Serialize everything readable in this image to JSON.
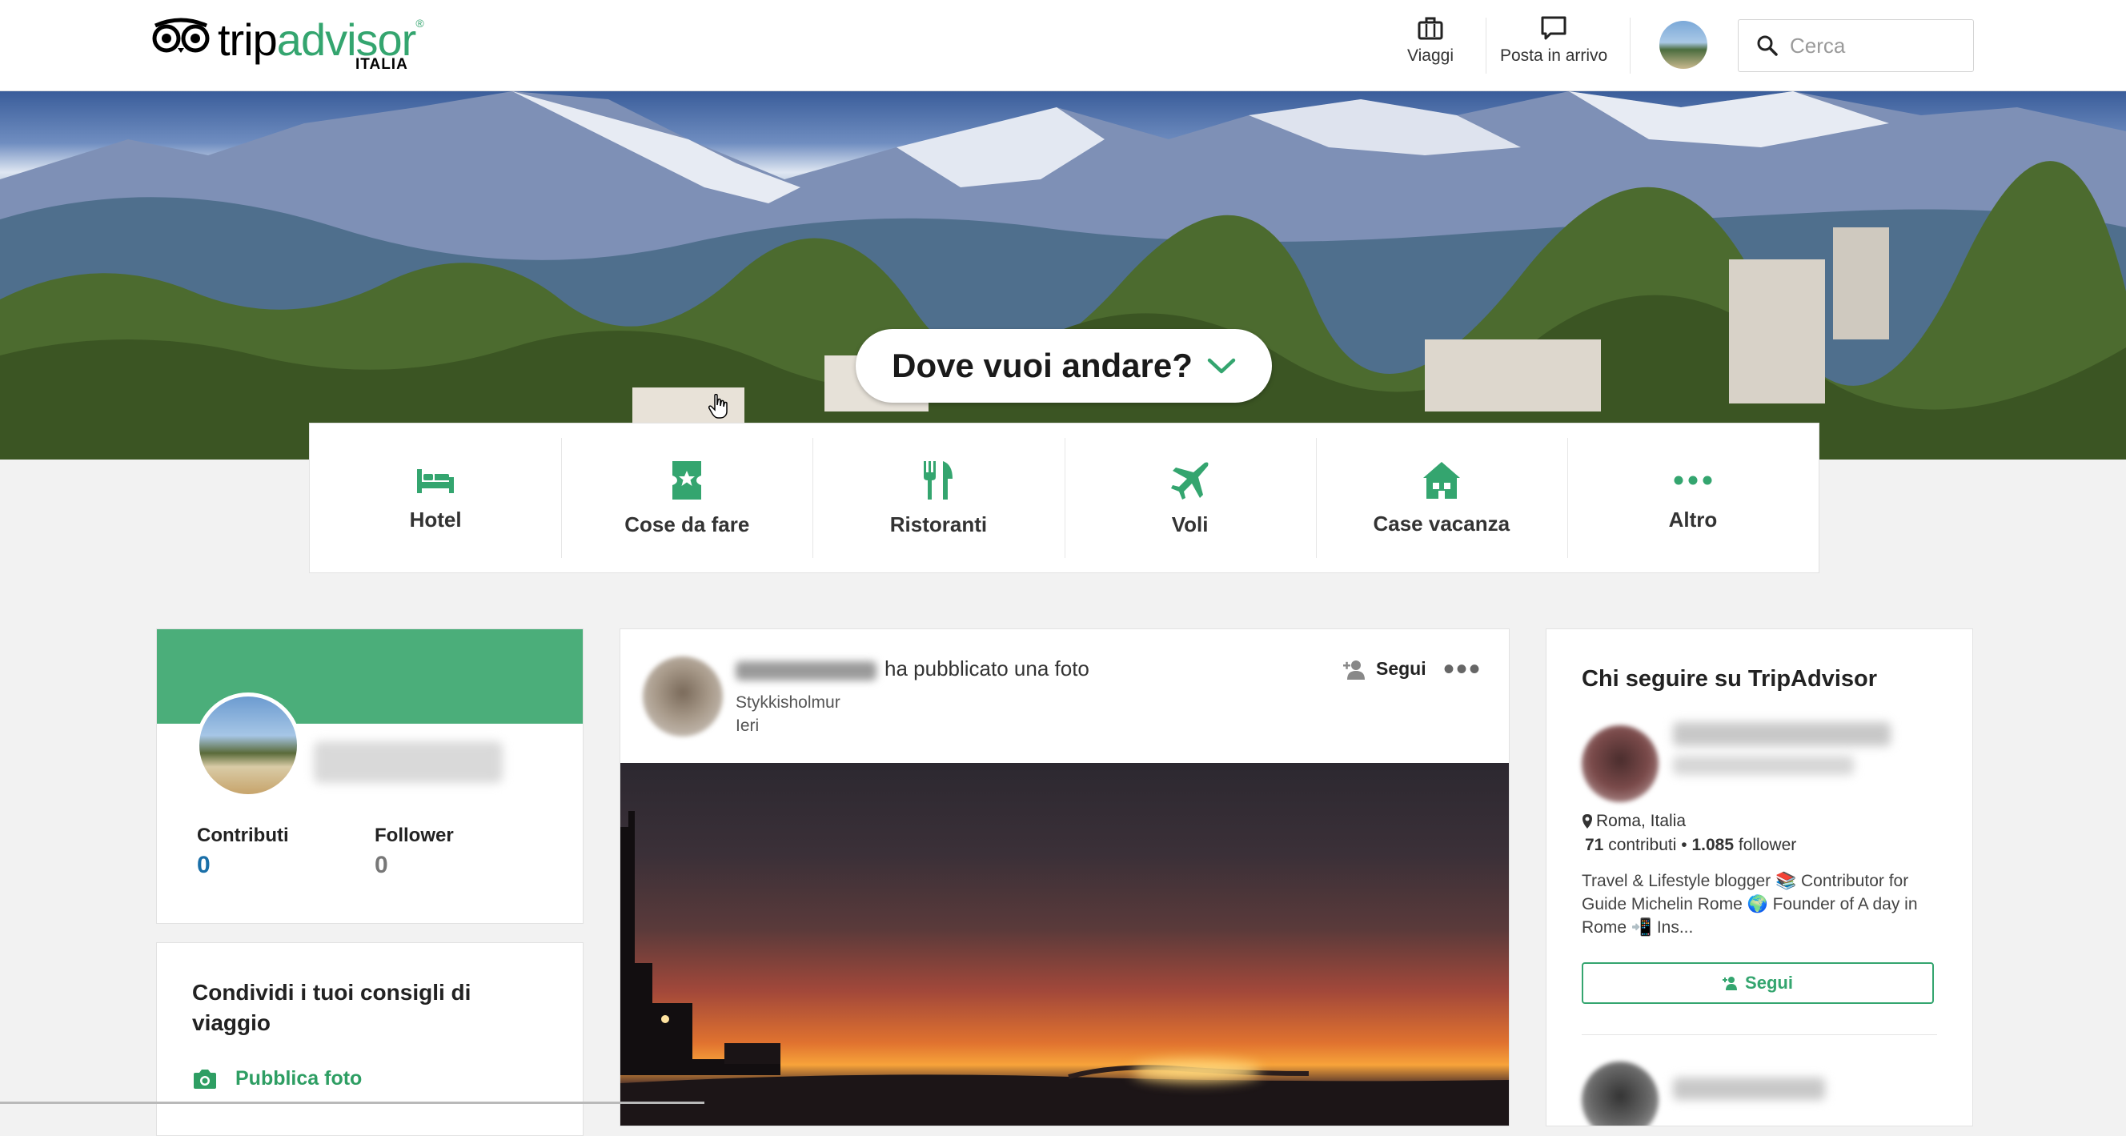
{
  "brand": {
    "name_part1": "trip",
    "name_part2": "advisor",
    "registered": "®",
    "country": "ITALIA",
    "green": "#34a56f"
  },
  "header": {
    "nav": [
      {
        "label": "Viaggi",
        "icon": "suitcase-icon"
      },
      {
        "label": "Posta in arrivo",
        "icon": "message-icon"
      }
    ],
    "search": {
      "placeholder": "Cerca",
      "icon": "search-icon"
    }
  },
  "hero": {
    "prompt": "Dove vuoi andare?",
    "icon": "chevron-down-icon"
  },
  "categories": [
    {
      "label": "Hotel",
      "icon": "bed-icon"
    },
    {
      "label": "Cose da fare",
      "icon": "ticket-star-icon"
    },
    {
      "label": "Ristoranti",
      "icon": "fork-knife-icon"
    },
    {
      "label": "Voli",
      "icon": "plane-icon"
    },
    {
      "label": "Case vacanza",
      "icon": "house-icon"
    },
    {
      "label": "Altro",
      "icon": "more-dots-icon"
    }
  ],
  "profile": {
    "stats": [
      {
        "label": "Contributi",
        "value": "0",
        "color": "#1a6fa8"
      },
      {
        "label": "Follower",
        "value": "0",
        "color": "#777777"
      }
    ]
  },
  "share": {
    "title": "Condividi i tuoi consigli di viaggio",
    "link": "Pubblica foto",
    "icon": "camera-icon"
  },
  "feed": {
    "action": "ha pubblicato una foto",
    "place": "Stykkisholmur",
    "time": "Ieri",
    "follow_label": "Segui",
    "more_label": "•••"
  },
  "suggestions": {
    "title": "Chi seguire su TripAdvisor",
    "item": {
      "location": "Roma, Italia",
      "contributions_count": "71",
      "contributions_word": "contributi",
      "separator": "•",
      "followers_count": "1.085",
      "followers_word": "follower",
      "bio": "Travel & Lifestyle blogger 📚 Contributor for Guide Michelin Rome 🌍 Founder of A day in Rome 📲 Ins...",
      "follow_label": "Segui"
    }
  }
}
